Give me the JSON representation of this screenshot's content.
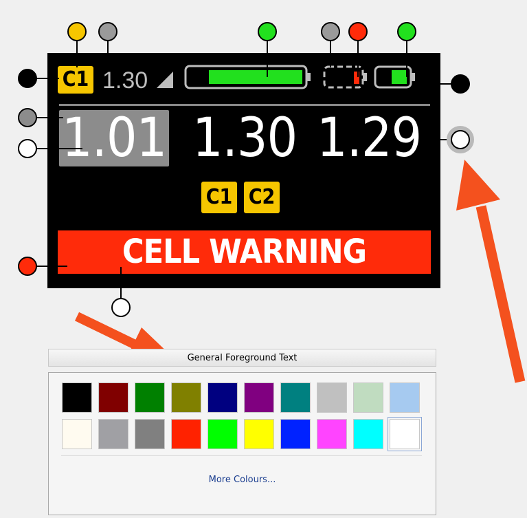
{
  "display": {
    "top_badge": "C1",
    "top_value": "1.30",
    "values": [
      "1.01",
      "1.30",
      "1.29"
    ],
    "cell_badges": [
      "C1",
      "C2"
    ],
    "warning": "CELL WARNING"
  },
  "picker": {
    "header_label": "General Foreground Text",
    "more_colours_label": "More Colours...",
    "swatches_row1": [
      "#000000",
      "#800000",
      "#008000",
      "#808000",
      "#000080",
      "#800080",
      "#008080",
      "#c0c0c0",
      "#c0dcc0",
      "#a6caf0"
    ],
    "swatches_row2": [
      "#fffbf0",
      "#a0a0a4",
      "#808080",
      "#ff2200",
      "#00ff00",
      "#ffff00",
      "#0022ff",
      "#ff44ff",
      "#00ffff",
      "#ffffff"
    ],
    "selected_color": "#ffffff"
  },
  "callouts": {
    "colors": [
      "#f6c600",
      "#9a9a9a",
      "#22e01e",
      "#9a9a9a",
      "#ff2b0a",
      "#22e01e",
      "#000000",
      "#000000",
      "#8c8c8c",
      "#ffffff",
      "#ffffff",
      "#ff2b0a",
      "#ffffff"
    ]
  },
  "arrow_color": "#f4511e"
}
